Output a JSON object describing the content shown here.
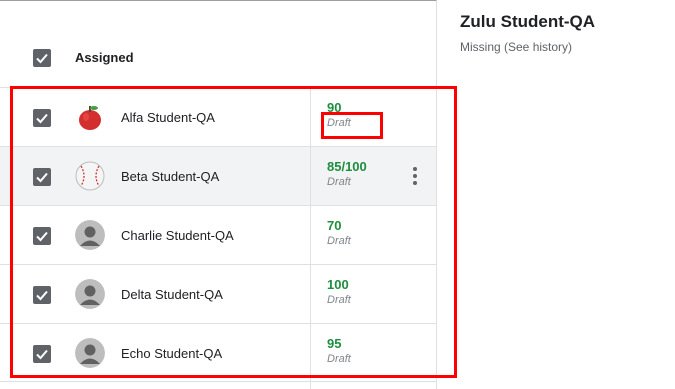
{
  "header": {
    "title": "Assigned"
  },
  "students": [
    {
      "name": "Alfa Student-QA",
      "grade": "90",
      "status": "Draft",
      "avatar": "apple-avatar"
    },
    {
      "name": "Beta Student-QA",
      "grade": "85/100",
      "status": "Draft",
      "avatar": "baseball-avatar"
    },
    {
      "name": "Charlie Student-QA",
      "grade": "70",
      "status": "Draft",
      "avatar": "default-person-avatar"
    },
    {
      "name": "Delta Student-QA",
      "grade": "100",
      "status": "Draft",
      "avatar": "default-person-avatar"
    },
    {
      "name": "Echo Student-QA",
      "grade": "95",
      "status": "Draft",
      "avatar": "default-person-avatar"
    }
  ],
  "detail": {
    "title": "Zulu Student-QA",
    "subtitle": "Missing (See history)"
  },
  "colors": {
    "grade": "#1e8e3e",
    "annotation": "#ff0000",
    "checkbox": "#5f6368"
  }
}
